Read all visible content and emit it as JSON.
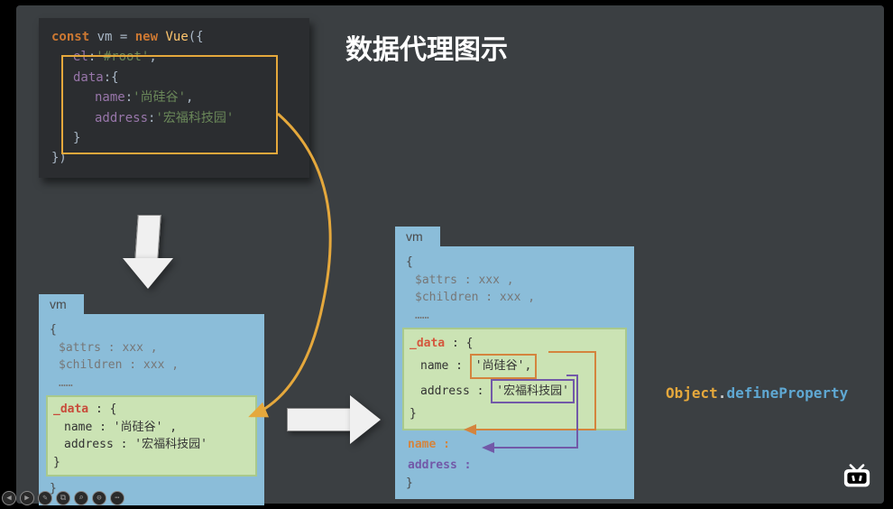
{
  "title": "数据代理图示",
  "code": {
    "l1_kw": "const",
    "l1_var": " vm ",
    "l1_eq": "= ",
    "l1_new": "new",
    "l1_cls": " Vue",
    "l1_paren": "({",
    "l2_prop": "el",
    "l2_colon": ":",
    "l2_val": "'#root'",
    "l2_comma": ",",
    "l3_prop": "data",
    "l3_colon": ":{",
    "l4_prop": "name",
    "l4_colon": ":",
    "l4_val": "'尚硅谷'",
    "l4_comma": ",",
    "l5_prop": "address",
    "l5_colon": ":",
    "l5_val": "'宏福科技园'",
    "l6_close": "}",
    "l7_close": "})"
  },
  "vm_left": {
    "tab": "vm",
    "open": "{",
    "attrs": "$attrs : xxx ,",
    "children": "$children : xxx ,",
    "dots": "……",
    "data_label": "_data",
    "data_open": " : {",
    "name_line": "name : '尚硅谷' ,",
    "addr_line": "address : '宏福科技园'",
    "data_close": "}",
    "close": "}"
  },
  "vm_right": {
    "tab": "vm",
    "open": "{",
    "attrs": "$attrs : xxx ,",
    "children": "$children : xxx ,",
    "dots": "……",
    "data_label": "_data",
    "data_open": " : {",
    "name_key": "name :",
    "name_val": "'尚硅谷',",
    "addr_key": "address :",
    "addr_val": "'宏福科技园'",
    "data_close": "}",
    "name_prop": "name :",
    "addr_prop": "address :",
    "close": "}"
  },
  "defineProp": {
    "obj": "Object",
    "dot": ".",
    "method": "defineProperty"
  }
}
